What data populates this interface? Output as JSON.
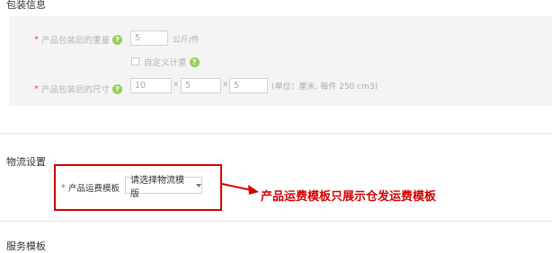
{
  "packaging": {
    "title": "包装信息",
    "weight_label": "产品包装后的重量",
    "weight_value": "5",
    "weight_unit": "公斤/件",
    "custom_weight_label": "自定义计重",
    "size_label": "产品包装后的尺寸",
    "size_values": [
      "10",
      "5",
      "5"
    ],
    "size_separator": "x",
    "size_hint": "(单位：厘米, 每件 250 cm3)"
  },
  "logistics": {
    "title": "物流设置",
    "template_label": "产品运费模板",
    "template_select_value": "请选择物流模版"
  },
  "service": {
    "title": "服务模板"
  },
  "annotation": {
    "text": "产品运费模板只展示仓发运费模板",
    "color": "#d40000"
  },
  "colors": {
    "required_star": "#d9534f",
    "help_icon": "#9acd5a"
  }
}
